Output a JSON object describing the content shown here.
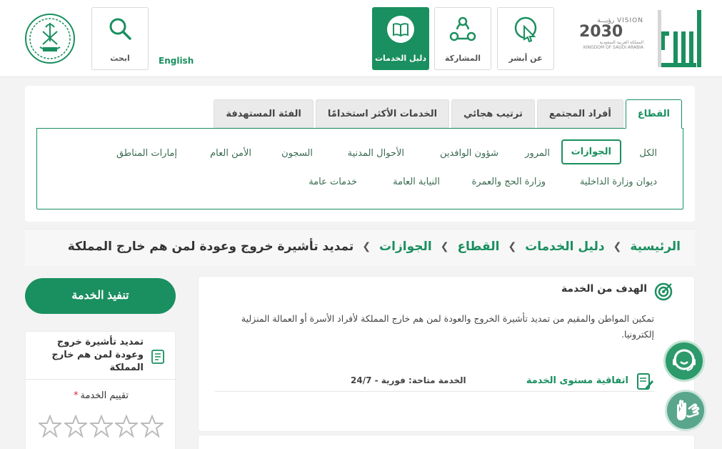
{
  "header": {
    "nav": {
      "about": "عن أبشر",
      "share": "المشاركة",
      "guide": "دليل الخدمات",
      "search": "ابحث"
    },
    "language": "English",
    "vision": {
      "arabic": "رؤيـــة",
      "year": "2030",
      "kingdom_ar": "المملكة العربية السعودية",
      "kingdom_en": "KINGDOM OF SAUDI ARABIA",
      "vision_en": "VISION"
    }
  },
  "sector_panel": {
    "tabs": [
      "القطاع",
      "أفراد المجتمع",
      "ترتيب هجائي",
      "الخدمات الأكثر استخدامًا",
      "الفئة المستهدفة"
    ],
    "active_tab": "القطاع",
    "chips_row1": [
      "الكل",
      "الجوازات",
      "المرور",
      "شؤون الوافدين",
      "الأحوال المدنية",
      "السجون",
      "الأمن العام",
      "إمارات المناطق"
    ],
    "chips_row2": [
      "ديوان وزارة الداخلية",
      "وزارة الحج والعمرة",
      "النيابة العامة",
      "خدمات عامة"
    ],
    "active_chip": "الجوازات"
  },
  "breadcrumb": [
    "الرئيسية",
    "دليل الخدمات",
    "القطاع",
    "الجوازات",
    "تمديد تأشيرة خروج وعودة لمن هم خارج المملكة"
  ],
  "service": {
    "goal_title": "الهدف من الخدمة",
    "goal_text": "تمكين المواطن والمقيم من تمديد تأشيرة الخروج والعودة لمن هم خارج المملكة لأفراد الأسرة أو العمالة المنزلية إلكترونيا.",
    "sla_label": "اتفاقية مستوى الخدمة",
    "availability": "الخدمة متاحة: فورية - 24/7"
  },
  "side": {
    "execute_button": "تنفيذ الخدمة",
    "service_name": "تمديد تأشيرة خروج وعودة لمن هم خارج المملكة",
    "rating_label": "تقييم الخدمة",
    "required_mark": "*",
    "rating_value": 0,
    "rating_max": 5
  },
  "colors": {
    "brand_green": "#1a8f5f",
    "required_red": "#d9222a"
  },
  "icons": {
    "about": "cursor-click-icon",
    "share": "share-network-icon",
    "guide": "book-icon",
    "search": "search-icon",
    "goal": "target-icon",
    "sla": "document-pen-icon",
    "chat": "chat-support-icon",
    "sign": "sign-language-icon"
  }
}
